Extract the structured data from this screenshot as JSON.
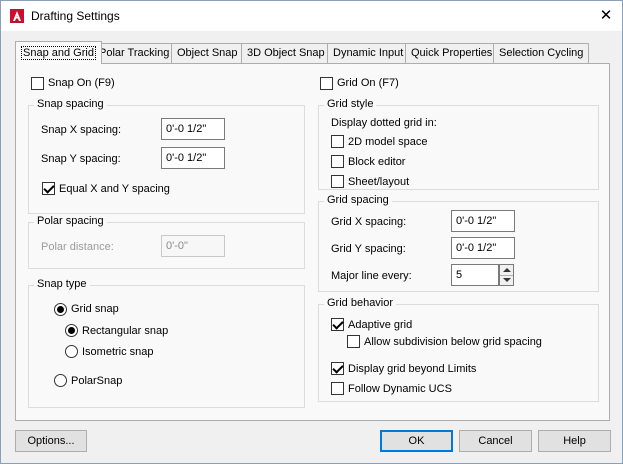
{
  "window": {
    "title": "Drafting Settings",
    "app_icon_color": "#c8102e"
  },
  "tabs": [
    {
      "label": "Snap and Grid",
      "active": true
    },
    {
      "label": "Polar Tracking"
    },
    {
      "label": "Object Snap"
    },
    {
      "label": "3D Object Snap"
    },
    {
      "label": "Dynamic Input"
    },
    {
      "label": "Quick Properties"
    },
    {
      "label": "Selection Cycling"
    }
  ],
  "snap": {
    "snap_on_label": "Snap On (F9)",
    "snap_on_checked": false,
    "spacing_group_title": "Snap spacing",
    "x_label": "Snap X spacing:",
    "x_value": "0'-0 1/2\"",
    "y_label": "Snap Y spacing:",
    "y_value": "0'-0 1/2\"",
    "equal_label": "Equal X and Y spacing",
    "equal_checked": true
  },
  "polar": {
    "group_title": "Polar spacing",
    "distance_label": "Polar distance:",
    "distance_value": "0'-0\""
  },
  "snap_type": {
    "group_title": "Snap type",
    "grid_snap": "Grid snap",
    "rectangular": "Rectangular snap",
    "isometric": "Isometric snap",
    "polarsnap": "PolarSnap"
  },
  "grid": {
    "grid_on_label": "Grid On (F7)",
    "grid_on_checked": false,
    "style_group_title": "Grid style",
    "display_dotted": "Display dotted grid in:",
    "model_space": "2D model space",
    "block_editor": "Block editor",
    "sheet_layout": "Sheet/layout",
    "spacing_group_title": "Grid spacing",
    "x_label": "Grid X spacing:",
    "x_value": "0'-0 1/2\"",
    "y_label": "Grid Y spacing:",
    "y_value": "0'-0 1/2\"",
    "major_label": "Major line every:",
    "major_value": "5",
    "behavior_group_title": "Grid behavior",
    "adaptive": "Adaptive grid",
    "allow_subdivision": "Allow subdivision below grid spacing",
    "beyond_limits": "Display grid beyond Limits",
    "follow_ucs": "Follow Dynamic UCS"
  },
  "buttons": {
    "options": "Options...",
    "ok": "OK",
    "cancel": "Cancel",
    "help": "Help"
  }
}
